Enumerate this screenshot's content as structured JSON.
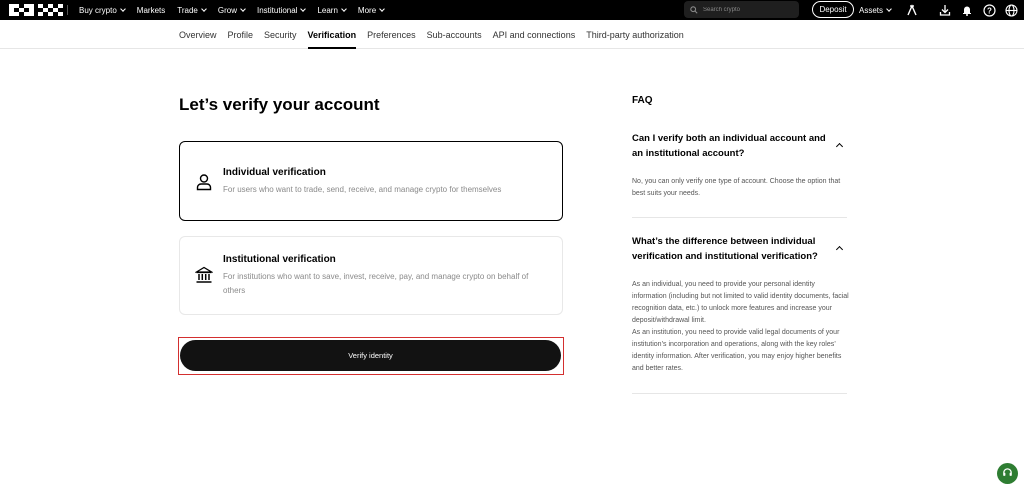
{
  "topnav": {
    "logo_text": "OKX",
    "items": [
      {
        "label": "Buy crypto",
        "dropdown": true
      },
      {
        "label": "Markets",
        "dropdown": false
      },
      {
        "label": "Trade",
        "dropdown": true
      },
      {
        "label": "Grow",
        "dropdown": true
      },
      {
        "label": "Institutional",
        "dropdown": true
      },
      {
        "label": "Learn",
        "dropdown": true
      },
      {
        "label": "More",
        "dropdown": true
      }
    ],
    "search_placeholder": "Search crypto",
    "deposit_label": "Deposit",
    "assets_label": "Assets",
    "icons": [
      "user-icon",
      "download-icon",
      "bell-icon",
      "help-icon",
      "globe-icon"
    ]
  },
  "subnav": {
    "items": [
      "Overview",
      "Profile",
      "Security",
      "Verification",
      "Preferences",
      "Sub-accounts",
      "API and connections",
      "Third-party authorization"
    ],
    "active": "Verification"
  },
  "main": {
    "title": "Let’s verify your account",
    "cards": [
      {
        "title": "Individual verification",
        "desc": "For users who want to trade, send, receive, and manage crypto for themselves",
        "icon": "person-icon"
      },
      {
        "title": "Institutional verification",
        "desc": "For institutions who want to save, invest, receive, pay, and manage crypto on behalf of others",
        "icon": "bank-icon"
      }
    ],
    "verify_label": "Verify identity"
  },
  "faq": {
    "title": "FAQ",
    "items": [
      {
        "q": "Can I verify both an individual account and an institutional account?",
        "a": "No, you can only verify one type of account. Choose the option that best suits your needs."
      },
      {
        "q": "What’s the difference between individual verification and institutional verification?",
        "a": "As an individual, you need to provide your personal identity information (including but not limited to valid identity documents, facial recognition data, etc.) to unlock more features and increase your deposit/withdrawal limit.",
        "a2": "As an institution, you need to provide valid legal documents of your institution’s incorporation and operations, along with the key roles’ identity information. After verification, you may enjoy higher benefits and better rates."
      }
    ]
  },
  "colors": {
    "accent": "#000000",
    "support": "#2e7d32",
    "highlight": "#d32f2f"
  }
}
